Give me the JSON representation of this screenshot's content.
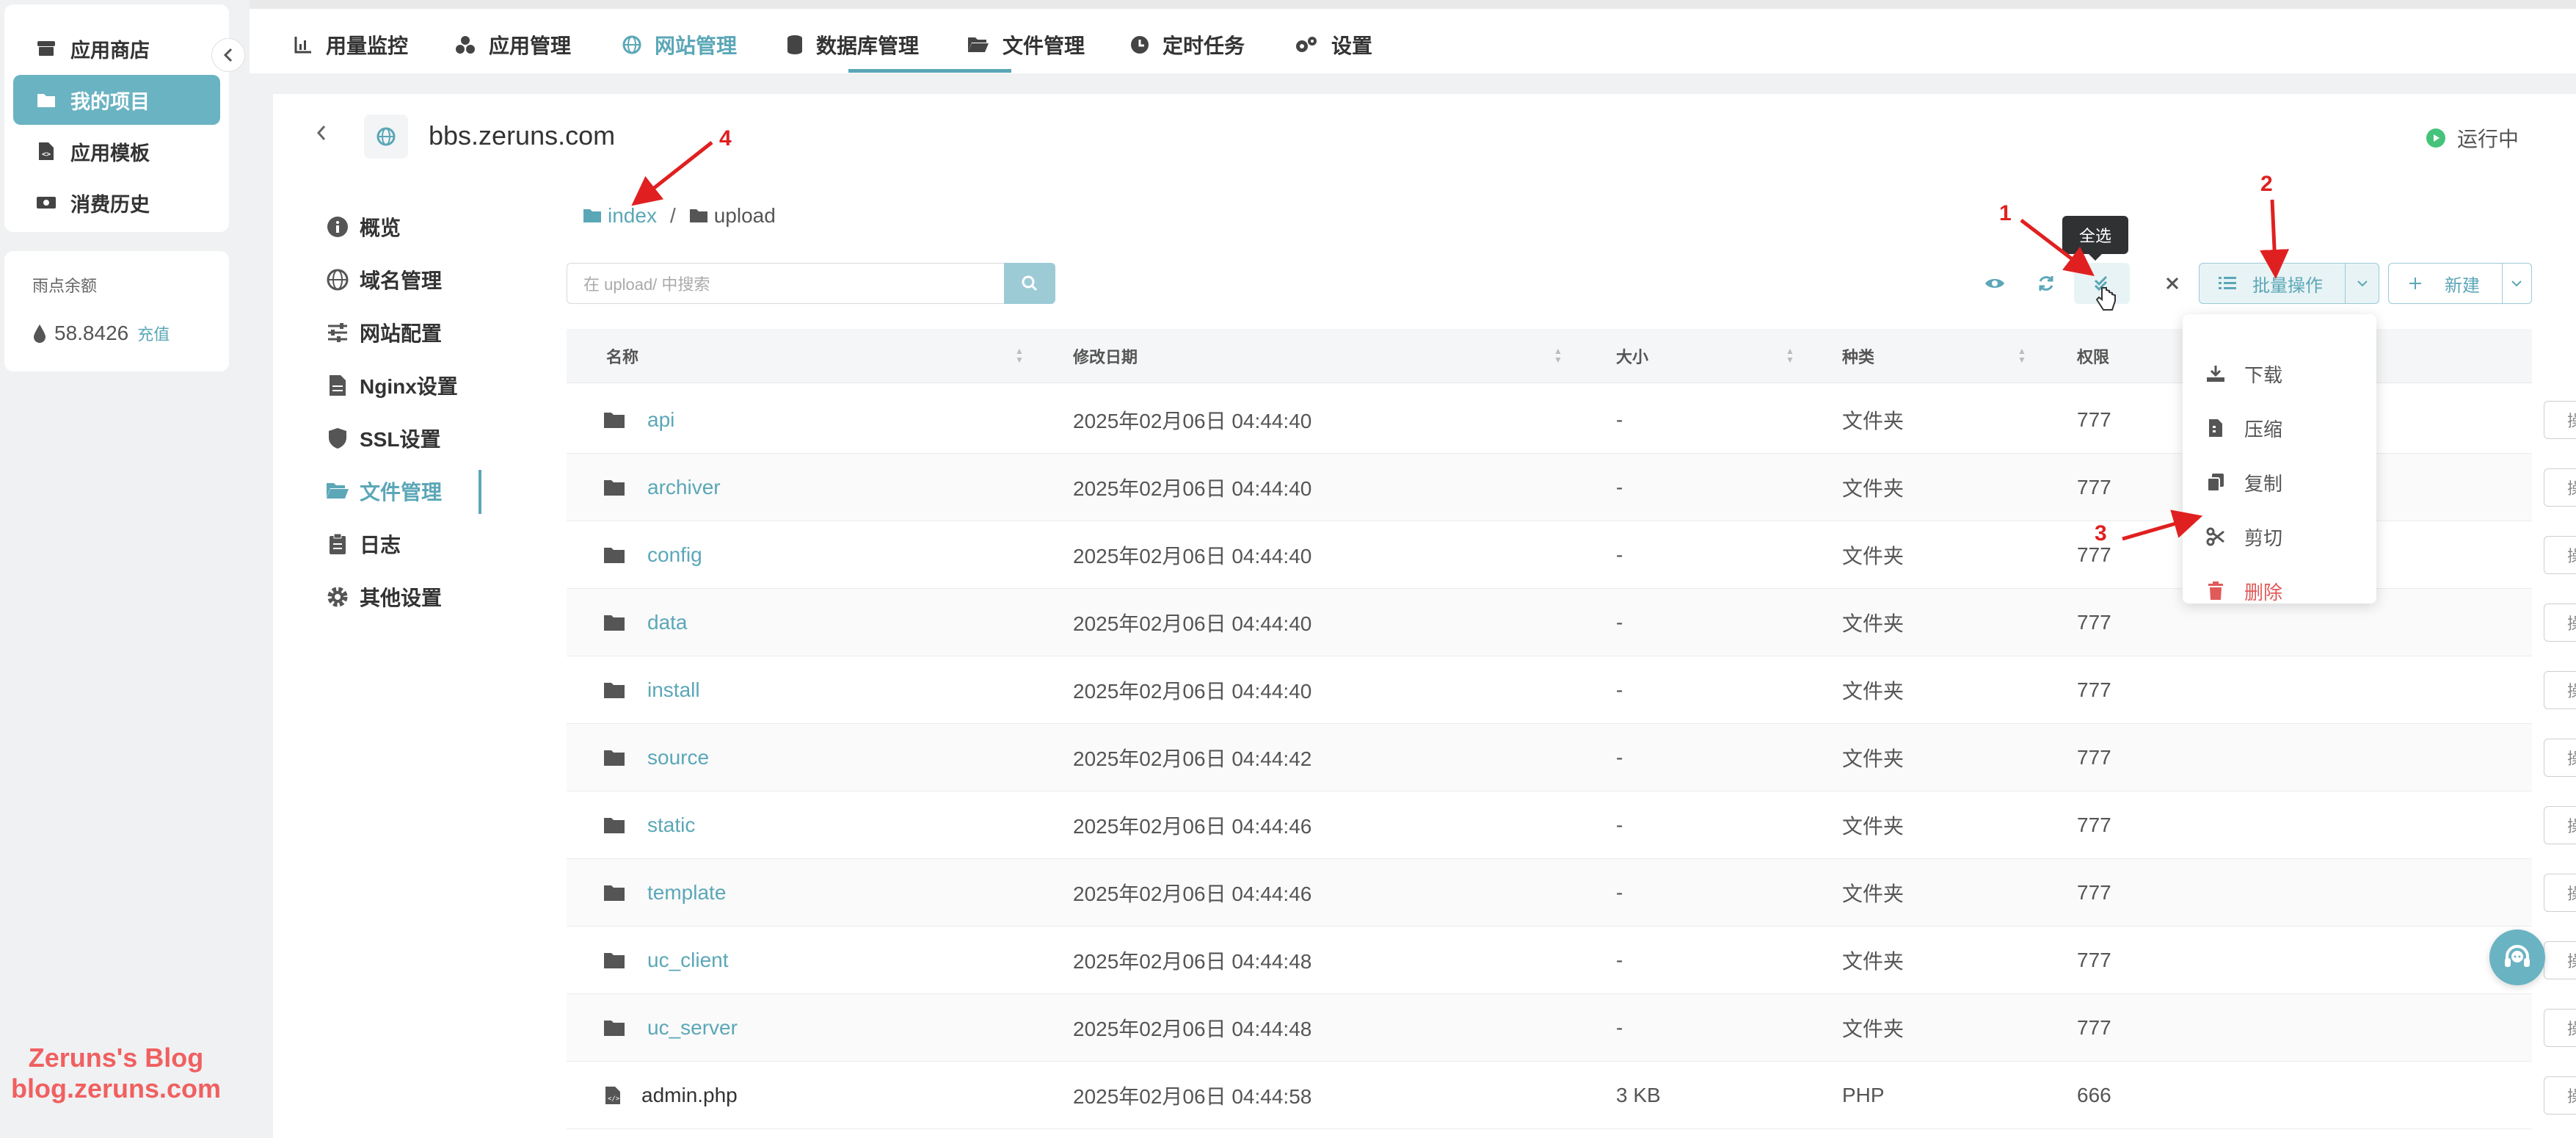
{
  "sidebar": {
    "items": [
      {
        "label": "应用商店",
        "icon": "store-icon"
      },
      {
        "label": "我的项目",
        "icon": "folder-icon"
      },
      {
        "label": "应用模板",
        "icon": "file-code-icon"
      },
      {
        "label": "消费历史",
        "icon": "money-icon"
      }
    ],
    "balance_label": "雨点余额",
    "balance_value": "58.8426",
    "recharge_label": "充值"
  },
  "topnav": {
    "tabs": [
      {
        "label": "用量监控",
        "icon": "chart-icon"
      },
      {
        "label": "应用管理",
        "icon": "apps-icon"
      },
      {
        "label": "网站管理",
        "icon": "globe-icon"
      },
      {
        "label": "数据库管理",
        "icon": "database-icon"
      },
      {
        "label": "文件管理",
        "icon": "folder-open-icon"
      },
      {
        "label": "定时任务",
        "icon": "clock-icon"
      },
      {
        "label": "设置",
        "icon": "gears-icon"
      }
    ]
  },
  "site": {
    "domain": "bbs.zeruns.com",
    "status": "运行中"
  },
  "menu": {
    "items": [
      {
        "label": "概览",
        "icon": "info-icon"
      },
      {
        "label": "域名管理",
        "icon": "globe-icon"
      },
      {
        "label": "网站配置",
        "icon": "sliders-icon"
      },
      {
        "label": "Nginx设置",
        "icon": "file-icon"
      },
      {
        "label": "SSL设置",
        "icon": "shield-icon"
      },
      {
        "label": "文件管理",
        "icon": "folder-open-icon"
      },
      {
        "label": "日志",
        "icon": "clipboard-icon"
      },
      {
        "label": "其他设置",
        "icon": "gear-icon"
      }
    ]
  },
  "breadcrumb": {
    "root": "index",
    "separator": "/",
    "current": "upload"
  },
  "toolbar": {
    "search_placeholder": "在 upload/ 中搜索",
    "select_all_tooltip": "全选",
    "batch_label": "批量操作",
    "new_label": "新建"
  },
  "batch_menu": {
    "items": [
      {
        "label": "下载",
        "icon": "download-icon"
      },
      {
        "label": "压缩",
        "icon": "file-zip-icon"
      },
      {
        "label": "复制",
        "icon": "copy-icon"
      },
      {
        "label": "剪切",
        "icon": "scissors-icon"
      },
      {
        "label": "删除",
        "icon": "trash-icon"
      }
    ]
  },
  "table": {
    "columns": [
      "名称",
      "修改日期",
      "大小",
      "种类",
      "权限"
    ],
    "op_label": "操作",
    "rows": [
      {
        "name": "api",
        "date": "2025年02月06日 04:44:40",
        "size": "-",
        "kind": "文件夹",
        "perm": "777",
        "type": "folder"
      },
      {
        "name": "archiver",
        "date": "2025年02月06日 04:44:40",
        "size": "-",
        "kind": "文件夹",
        "perm": "777",
        "type": "folder"
      },
      {
        "name": "config",
        "date": "2025年02月06日 04:44:40",
        "size": "-",
        "kind": "文件夹",
        "perm": "777",
        "type": "folder"
      },
      {
        "name": "data",
        "date": "2025年02月06日 04:44:40",
        "size": "-",
        "kind": "文件夹",
        "perm": "777",
        "type": "folder"
      },
      {
        "name": "install",
        "date": "2025年02月06日 04:44:40",
        "size": "-",
        "kind": "文件夹",
        "perm": "777",
        "type": "folder"
      },
      {
        "name": "source",
        "date": "2025年02月06日 04:44:42",
        "size": "-",
        "kind": "文件夹",
        "perm": "777",
        "type": "folder"
      },
      {
        "name": "static",
        "date": "2025年02月06日 04:44:46",
        "size": "-",
        "kind": "文件夹",
        "perm": "777",
        "type": "folder"
      },
      {
        "name": "template",
        "date": "2025年02月06日 04:44:46",
        "size": "-",
        "kind": "文件夹",
        "perm": "777",
        "type": "folder"
      },
      {
        "name": "uc_client",
        "date": "2025年02月06日 04:44:48",
        "size": "-",
        "kind": "文件夹",
        "perm": "777",
        "type": "folder"
      },
      {
        "name": "uc_server",
        "date": "2025年02月06日 04:44:48",
        "size": "-",
        "kind": "文件夹",
        "perm": "777",
        "type": "folder"
      },
      {
        "name": "admin.php",
        "date": "2025年02月06日 04:44:58",
        "size": "3 KB",
        "kind": "PHP",
        "perm": "666",
        "type": "file"
      }
    ]
  },
  "annotations": [
    "1",
    "2",
    "3",
    "4"
  ],
  "watermark": {
    "line1": "Zeruns's Blog",
    "line2": "blog.zeruns.com"
  },
  "colors": {
    "accent": "#5ba7b7",
    "active_bg": "#6ab3c2",
    "danger": "#e05a5a",
    "annotation": "#e02020",
    "running": "#46c37b"
  }
}
